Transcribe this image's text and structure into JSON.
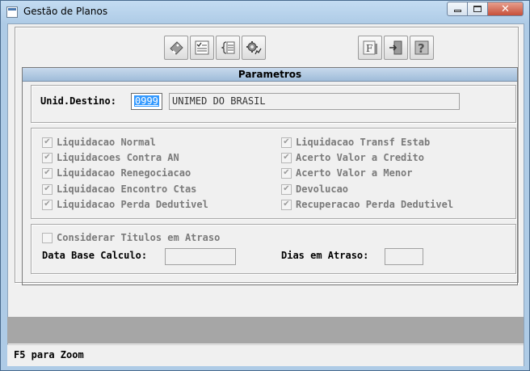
{
  "window": {
    "title": "Gestão de Planos",
    "controls": {
      "minimize": "",
      "maximize": "",
      "close": "✕"
    }
  },
  "toolbar": {
    "buttons": [
      {
        "icon": "eraser-tag-icon"
      },
      {
        "icon": "checklist-icon"
      },
      {
        "icon": "list-bracket-icon"
      },
      {
        "icon": "gear-graph-icon"
      },
      {
        "icon": "letter-f-icon"
      },
      {
        "icon": "exit-door-icon"
      },
      {
        "icon": "help-question-icon"
      }
    ]
  },
  "parametros": {
    "header": "Parametros",
    "unid_destino": {
      "label": "Unid.Destino:",
      "code": "0999",
      "name": "UNIMED DO BRASIL"
    },
    "liquidacao_options_left": [
      {
        "label": "Liquidacao Normal",
        "checked": true
      },
      {
        "label": "Liquidacoes Contra AN",
        "checked": true
      },
      {
        "label": "Liquidacao Renegociacao",
        "checked": true
      },
      {
        "label": "Liquidacao Encontro Ctas",
        "checked": true
      },
      {
        "label": "Liquidacao Perda Dedutivel",
        "checked": true
      }
    ],
    "liquidacao_options_right": [
      {
        "label": "Liquidacao Transf Estab",
        "checked": true
      },
      {
        "label": "Acerto Valor a Credito",
        "checked": true
      },
      {
        "label": "Acerto Valor a Menor",
        "checked": true
      },
      {
        "label": "Devolucao",
        "checked": true
      },
      {
        "label": "Recuperacao Perda Dedutivel",
        "checked": true
      }
    ],
    "atraso": {
      "considerar_label": "Considerar Titulos em Atraso",
      "considerar_checked": false,
      "data_base_label": "Data Base Calculo:",
      "data_base_value": "",
      "dias_label": "Dias em Atraso:",
      "dias_value": ""
    }
  },
  "status_bar": {
    "text": "F5 para Zoom"
  },
  "colors": {
    "window_frame": "#aecbe6",
    "header_band": "#9fbcd9",
    "selection": "#3399ff",
    "gray_band": "#a6a6a6"
  }
}
